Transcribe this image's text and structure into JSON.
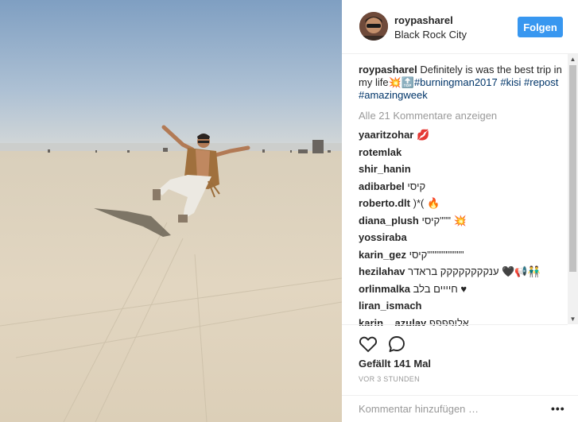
{
  "post": {
    "username": "roypasharel",
    "location": "Black Rock City",
    "follow_label": "Folgen",
    "caption": {
      "username": "roypasharel",
      "text": "Definitely is was the best trip in my life",
      "emoji": "💥🔝",
      "hashtags": [
        "#burningman2017",
        "#kisi",
        "#repost",
        "#amazingweek"
      ]
    },
    "load_more": "Alle 21 Kommentare anzeigen",
    "comments": [
      {
        "user": "yaaritzohar",
        "text": "💋"
      },
      {
        "user": "rotemlak",
        "text": ""
      },
      {
        "user": "shir_hanin",
        "text": ""
      },
      {
        "user": "adibarbel",
        "text": "קיסי"
      },
      {
        "user": "roberto.dlt",
        "text": ")*( 🔥"
      },
      {
        "user": "diana_plush",
        "text": "קיסי\"\"\" 💥"
      },
      {
        "user": "yossiraba",
        "text": ""
      },
      {
        "user": "karin_gez",
        "text": "קיסי\"\"\"\"\"\"\"\"\"\""
      },
      {
        "user": "hezilahav",
        "text": "ענקקקקקקקק בראדר 🖤📢👬"
      },
      {
        "user": "orlinmalka",
        "text": "חיייים בלב ♥"
      },
      {
        "user": "liran_ismach",
        "text": ""
      },
      {
        "user": "karin__azulay",
        "text": "אלופפפפ"
      }
    ],
    "likes": "Gefällt 141 Mal",
    "time": "VOR 3 STUNDEN",
    "comment_placeholder": "Kommentar hinzufügen …",
    "more_label": "•••"
  },
  "icons": {
    "like": "heart-outline-icon",
    "comment": "comment-bubble-icon",
    "scroll_up": "triangle-up-icon",
    "scroll_down": "triangle-down-icon"
  },
  "colors": {
    "follow_button": "#3897f0",
    "hashtag": "#003569",
    "muted": "#999999"
  }
}
